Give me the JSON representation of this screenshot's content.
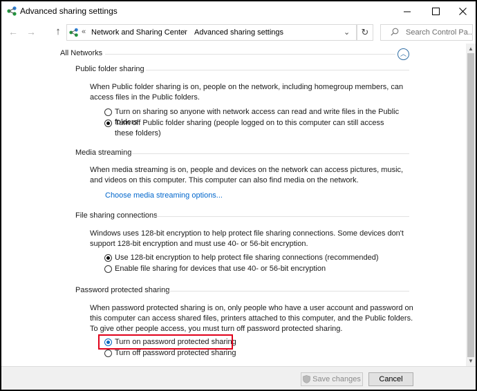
{
  "window": {
    "title": "Advanced sharing settings"
  },
  "address": {
    "overflow": "«",
    "crumbs": [
      "Network and Sharing Center",
      "Advanced sharing settings"
    ],
    "separator": "›",
    "search_placeholder": "Search Control Pa..."
  },
  "all_networks": {
    "heading": "All Networks"
  },
  "public_folder": {
    "title": "Public folder sharing",
    "description": "When Public folder sharing is on, people on the network, including homegroup members, can access files in the Public folders.",
    "options": [
      {
        "label": "Turn on sharing so anyone with network access can read and write files in the Public folders",
        "checked": false
      },
      {
        "label": "Turn off Public folder sharing (people logged on to this computer can still access these folders)",
        "checked": true
      }
    ]
  },
  "media_streaming": {
    "title": "Media streaming",
    "description": "When media streaming is on, people and devices on the network can access pictures, music, and videos on this computer. This computer can also find media on the network.",
    "link": "Choose media streaming options..."
  },
  "file_sharing": {
    "title": "File sharing connections",
    "description": "Windows uses 128-bit encryption to help protect file sharing connections. Some devices don't support 128-bit encryption and must use 40- or 56-bit encryption.",
    "options": [
      {
        "label": "Use 128-bit encryption to help protect file sharing connections (recommended)",
        "checked": true
      },
      {
        "label": "Enable file sharing for devices that use 40- or 56-bit encryption",
        "checked": false
      }
    ]
  },
  "password_sharing": {
    "title": "Password protected sharing",
    "description": "When password protected sharing is on, only people who have a user account and password on this computer can access shared files, printers attached to this computer, and the Public folders. To give other people access, you must turn off password protected sharing.",
    "options": [
      {
        "label": "Turn on password protected sharing",
        "checked": true
      },
      {
        "label": "Turn off password protected sharing",
        "checked": false
      }
    ]
  },
  "buttons": {
    "save": "Save changes",
    "cancel": "Cancel"
  },
  "colors": {
    "link": "#0066cc",
    "highlight": "#e0001a",
    "accent": "#0067c0"
  }
}
